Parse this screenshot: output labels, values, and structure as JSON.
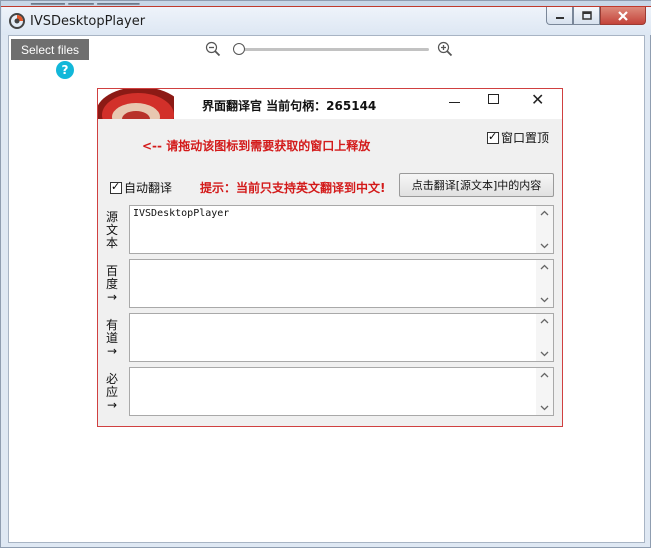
{
  "window": {
    "title": "IVSDesktopPlayer"
  },
  "toolbar": {
    "select_files": "Select files",
    "help": "?",
    "zoom_level": 0.02
  },
  "dialog": {
    "title": "界面翻译官 当前句柄：265144",
    "drag_hint": "<-- 请拖动该图标到需要获取的窗口上释放",
    "topmost_label": "窗口置顶",
    "auto_translate_label": "自动翻译",
    "tip": "提示：当前只支持英文翻译到中文!",
    "translate_button": "点击翻译[源文本]中的内容",
    "rows": [
      {
        "label": "源文本",
        "value": "IVSDesktopPlayer"
      },
      {
        "label": "百度→",
        "value": ""
      },
      {
        "label": "有道→",
        "value": ""
      },
      {
        "label": "必应→",
        "value": ""
      }
    ]
  }
}
